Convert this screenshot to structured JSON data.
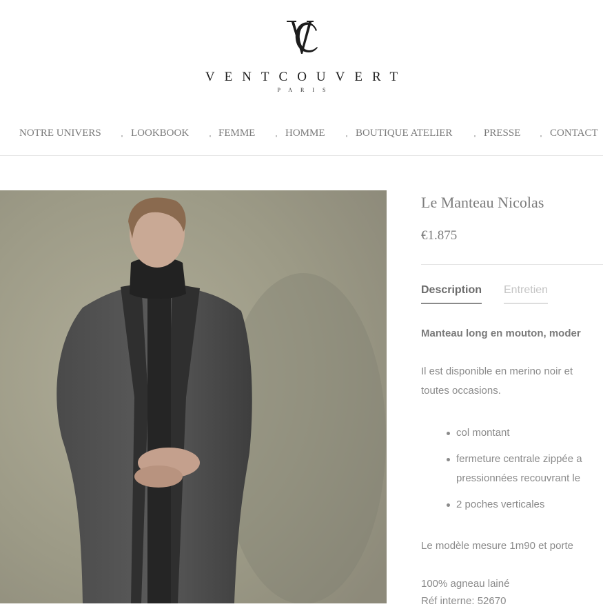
{
  "brand": {
    "name": "VENTCOUVERT",
    "city": "PARIS",
    "monogram_icon": "vc-monogram-icon"
  },
  "nav": {
    "items": [
      {
        "label": "NOTRE UNIVERS"
      },
      {
        "label": "LOOKBOOK"
      },
      {
        "label": "FEMME"
      },
      {
        "label": "HOMME"
      },
      {
        "label": "BOUTIQUE ATELIER"
      },
      {
        "label": "PRESSE"
      },
      {
        "label": "CONTACT"
      }
    ]
  },
  "product": {
    "title": "Le Manteau Nicolas",
    "price": "€1.875",
    "tabs": {
      "description": "Description",
      "care": "Entretien"
    },
    "description": {
      "lead": "Manteau long en mouton, moder",
      "availability_line1": "Il est disponible en merino noir et",
      "availability_line2": "toutes occasions.",
      "features": [
        {
          "line1": "col montant",
          "line2": ""
        },
        {
          "line1": "fermeture centrale zippée a",
          "line2": "pressionnées recouvrant le"
        },
        {
          "line1": "2 poches verticales",
          "line2": ""
        }
      ],
      "model_info": "Le modèle mesure 1m90 et porte",
      "composition": "100% agneau lainé",
      "reference": "Réf interne: 52670"
    }
  },
  "colors": {
    "text_primary": "#6f6f6f",
    "text_muted": "#c4c4c4",
    "brand_dark": "#1c1c1c",
    "image_backdrop": "#9c9a86",
    "coat": "#3c3c3c"
  }
}
